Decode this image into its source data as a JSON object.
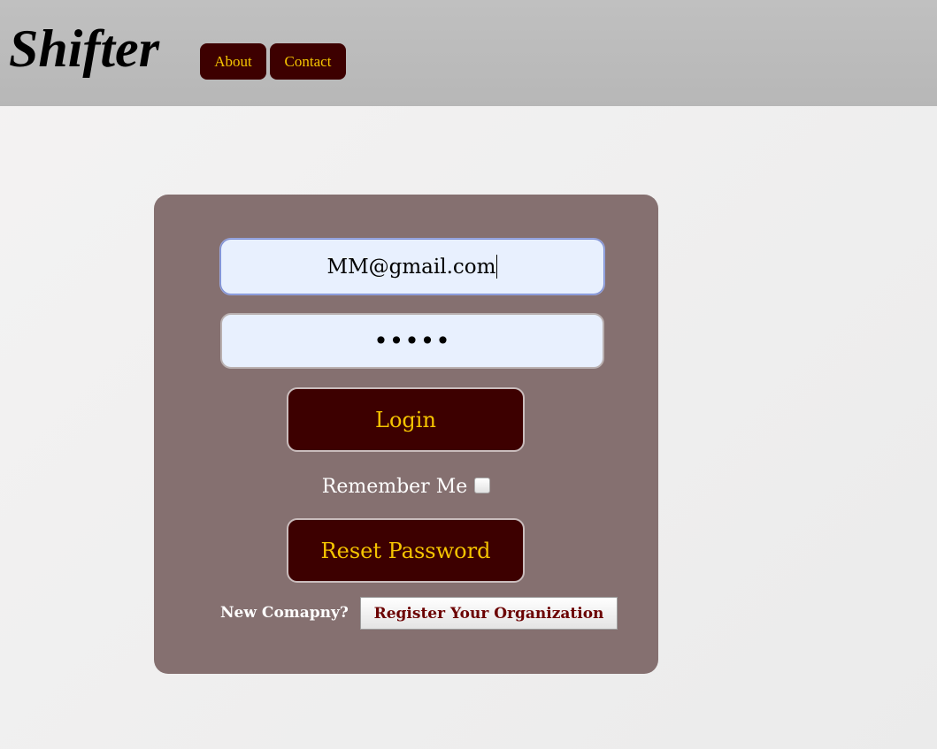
{
  "header": {
    "logo": "Shifter",
    "nav": {
      "about": "About",
      "contact": "Contact"
    }
  },
  "login": {
    "email_value": "MM@gmail.com",
    "password_masked": "•••••",
    "login_label": "Login",
    "remember_label": "Remember Me",
    "remember_checked": false,
    "reset_label": "Reset Password",
    "new_company_label": "New Comapny?",
    "register_label": "Register Your Organization"
  },
  "colors": {
    "button_bg": "#3d0000",
    "button_text": "#f5c400",
    "card_bg": "#857070",
    "input_bg": "#e8f0fe"
  }
}
